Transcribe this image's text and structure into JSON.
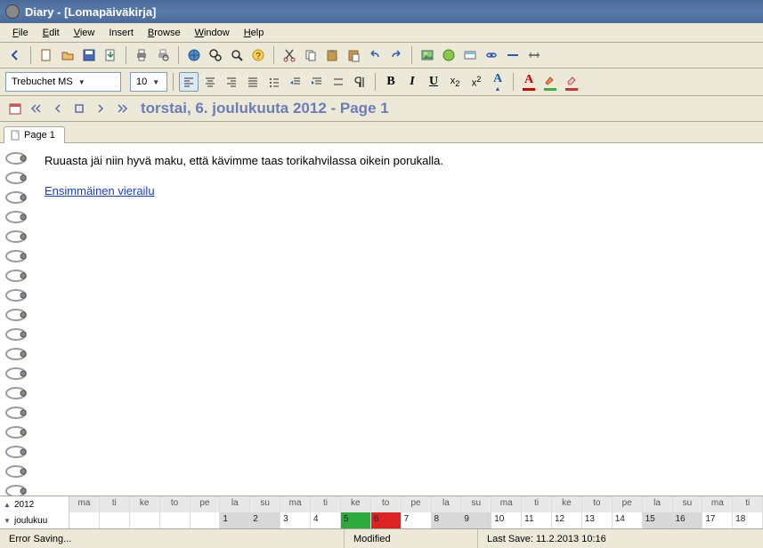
{
  "window": {
    "title": "Diary - [Lomapäiväkirja]"
  },
  "menu": {
    "file": "File",
    "edit": "Edit",
    "view": "View",
    "insert": "Insert",
    "browse": "Browse",
    "window": "Window",
    "help": "Help"
  },
  "toolbar": {
    "font_name": "Trebuchet MS",
    "font_size": "10"
  },
  "nav": {
    "date_title": "torstai, 6. joulukuuta 2012 - Page 1"
  },
  "tabs": {
    "page1": "Page 1"
  },
  "entry": {
    "line1": "Ruuasta jäi niin hyvä maku, että kävimme taas torikahvilassa oikein porukalla.",
    "link": "Ensimmäinen vierailu"
  },
  "calendar": {
    "year_label": "2012",
    "month_label": "joulukuu",
    "weekdays": [
      "ma",
      "ti",
      "ke",
      "to",
      "pe",
      "la",
      "su",
      "ma",
      "ti",
      "ke",
      "to",
      "pe",
      "la",
      "su",
      "ma",
      "ti",
      "ke",
      "to",
      "pe",
      "la",
      "su",
      "ma",
      "ti"
    ],
    "days": [
      "",
      "",
      "",
      "",
      "",
      "1",
      "2",
      "3",
      "4",
      "5",
      "6",
      "7",
      "8",
      "9",
      "10",
      "11",
      "12",
      "13",
      "14",
      "15",
      "16",
      "17",
      "18"
    ]
  },
  "status": {
    "left": "Error Saving...",
    "center": "Modified",
    "right": "Last Save: 11.2.2013 10:16"
  }
}
